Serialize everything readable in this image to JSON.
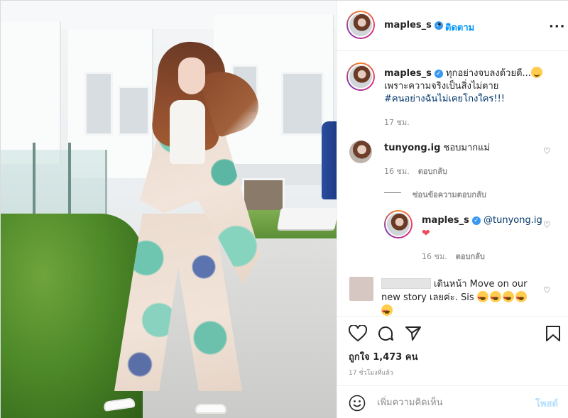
{
  "header": {
    "username": "maples_s",
    "separator": "•",
    "follow_label": "ติดตาม",
    "more_label": "···"
  },
  "caption": {
    "username": "maples_s",
    "line1": "ทุกอย่างจบลงด้วยดี...",
    "line2": "เพราะความจริงเป็นสิ่งไม่ตาย",
    "hashtag": "#คนอย่างฉันไม่เคยโกงใคร!!!",
    "time": "17 ชม."
  },
  "comments": [
    {
      "username": "tunyong.ig",
      "text": "ชอบมากแม่",
      "time": "16 ชม.",
      "reply_label": "ตอบกลับ",
      "hide_replies_label": "ซ่อนข้อความตอบกลับ",
      "replies": [
        {
          "username": "maples_s",
          "mention": "@tunyong.ig",
          "time": "16 ชม.",
          "reply_label": "ตอบกลับ"
        }
      ]
    },
    {
      "username": "",
      "text_line1": "เดินหน้า Move on our",
      "text_line2": "new story เลยค่ะ. Sis"
    }
  ],
  "actions": {
    "icons": [
      "heart-icon",
      "comment-icon",
      "share-icon",
      "bookmark-icon"
    ],
    "likes": "ถูกใจ 1,473 คน",
    "posted_ago": "17 ชั่วโมงที่แล้ว"
  },
  "add_comment": {
    "placeholder": "เพิ่มความคิดเห็น",
    "post_label": "โพสต์"
  },
  "colors": {
    "link": "#0095f6",
    "verified": "#3897f0",
    "post_disabled": "#b2dffc",
    "red_heart": "#ed4956",
    "hashtag": "#00376b"
  }
}
